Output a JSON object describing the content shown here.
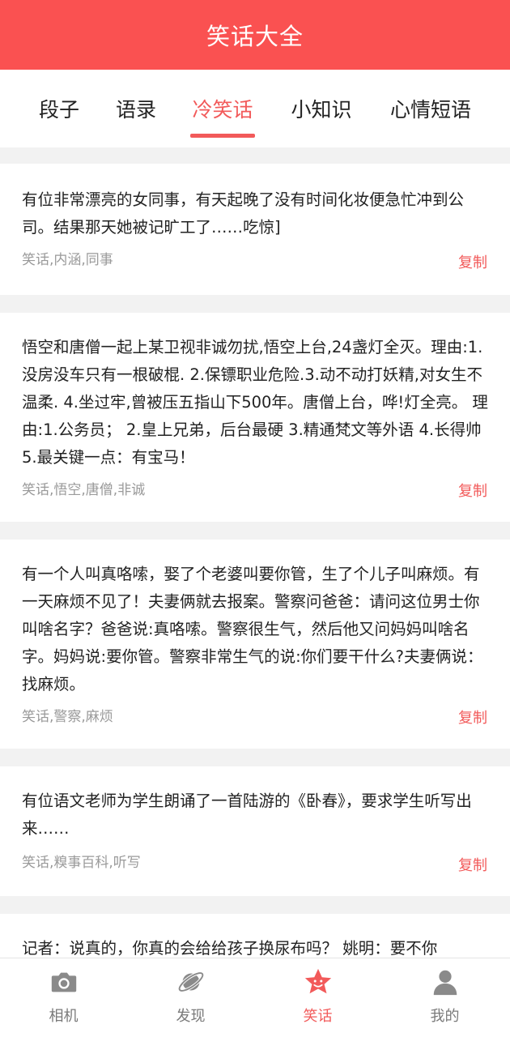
{
  "header": {
    "title": "笑话大全"
  },
  "tabs": [
    {
      "label": "段子"
    },
    {
      "label": "语录"
    },
    {
      "label": "冷笑话"
    },
    {
      "label": "小知识"
    },
    {
      "label": "心情短语"
    }
  ],
  "active_tab": "冷笑话",
  "jokes": [
    {
      "text": "有位非常漂亮的女同事，有天起晚了没有时间化妆便急忙冲到公司。结果那天她被记旷工了……吃惊]",
      "tags": "笑话,内涵,同事",
      "copy_label": "复制"
    },
    {
      "text": "悟空和唐僧一起上某卫视非诚勿扰,悟空上台,24盏灯全灭。理由:1.没房没车只有一根破棍. 2.保镖职业危险.3.动不动打妖精,对女生不温柔. 4.坐过牢,曾被压五指山下500年。唐僧上台，哗!灯全亮。 理由:1.公务员； 2.皇上兄弟，后台最硬 3.精通梵文等外语 4.长得帅 5.最关键一点：有宝马！",
      "tags": "笑话,悟空,唐僧,非诚",
      "copy_label": "复制"
    },
    {
      "text": "有一个人叫真咯嗦，娶了个老婆叫要你管，生了个儿子叫麻烦。有一天麻烦不见了！夫妻俩就去报案。警察问爸爸：请问这位男士你叫啥名字？爸爸说:真咯嗦。警察很生气，然后他又问妈妈叫啥名字。妈妈说:要你管。警察非常生气的说:你们要干什么?夫妻俩说：找麻烦。",
      "tags": "笑话,警察,麻烦",
      "copy_label": "复制"
    },
    {
      "text": "有位语文老师为学生朗诵了一首陆游的《卧春》，要求学生听写出来……",
      "tags": "笑话,糗事百科,听写",
      "copy_label": "复制"
    },
    {
      "text": "记者：说真的，你真的会给给孩子换尿布吗？ 姚明：要不你",
      "tags": "",
      "copy_label": ""
    }
  ],
  "bottom_nav": [
    {
      "label": "相机",
      "icon": "camera-icon"
    },
    {
      "label": "发现",
      "icon": "planet-icon"
    },
    {
      "label": "笑话",
      "icon": "star-icon"
    },
    {
      "label": "我的",
      "icon": "person-icon"
    }
  ],
  "active_nav": "笑话",
  "colors": {
    "header_bg": "#fa5151",
    "accent": "#f25a5a",
    "page_bg": "#f2f2f2",
    "text": "#222222",
    "muted": "#9a9a9a"
  }
}
